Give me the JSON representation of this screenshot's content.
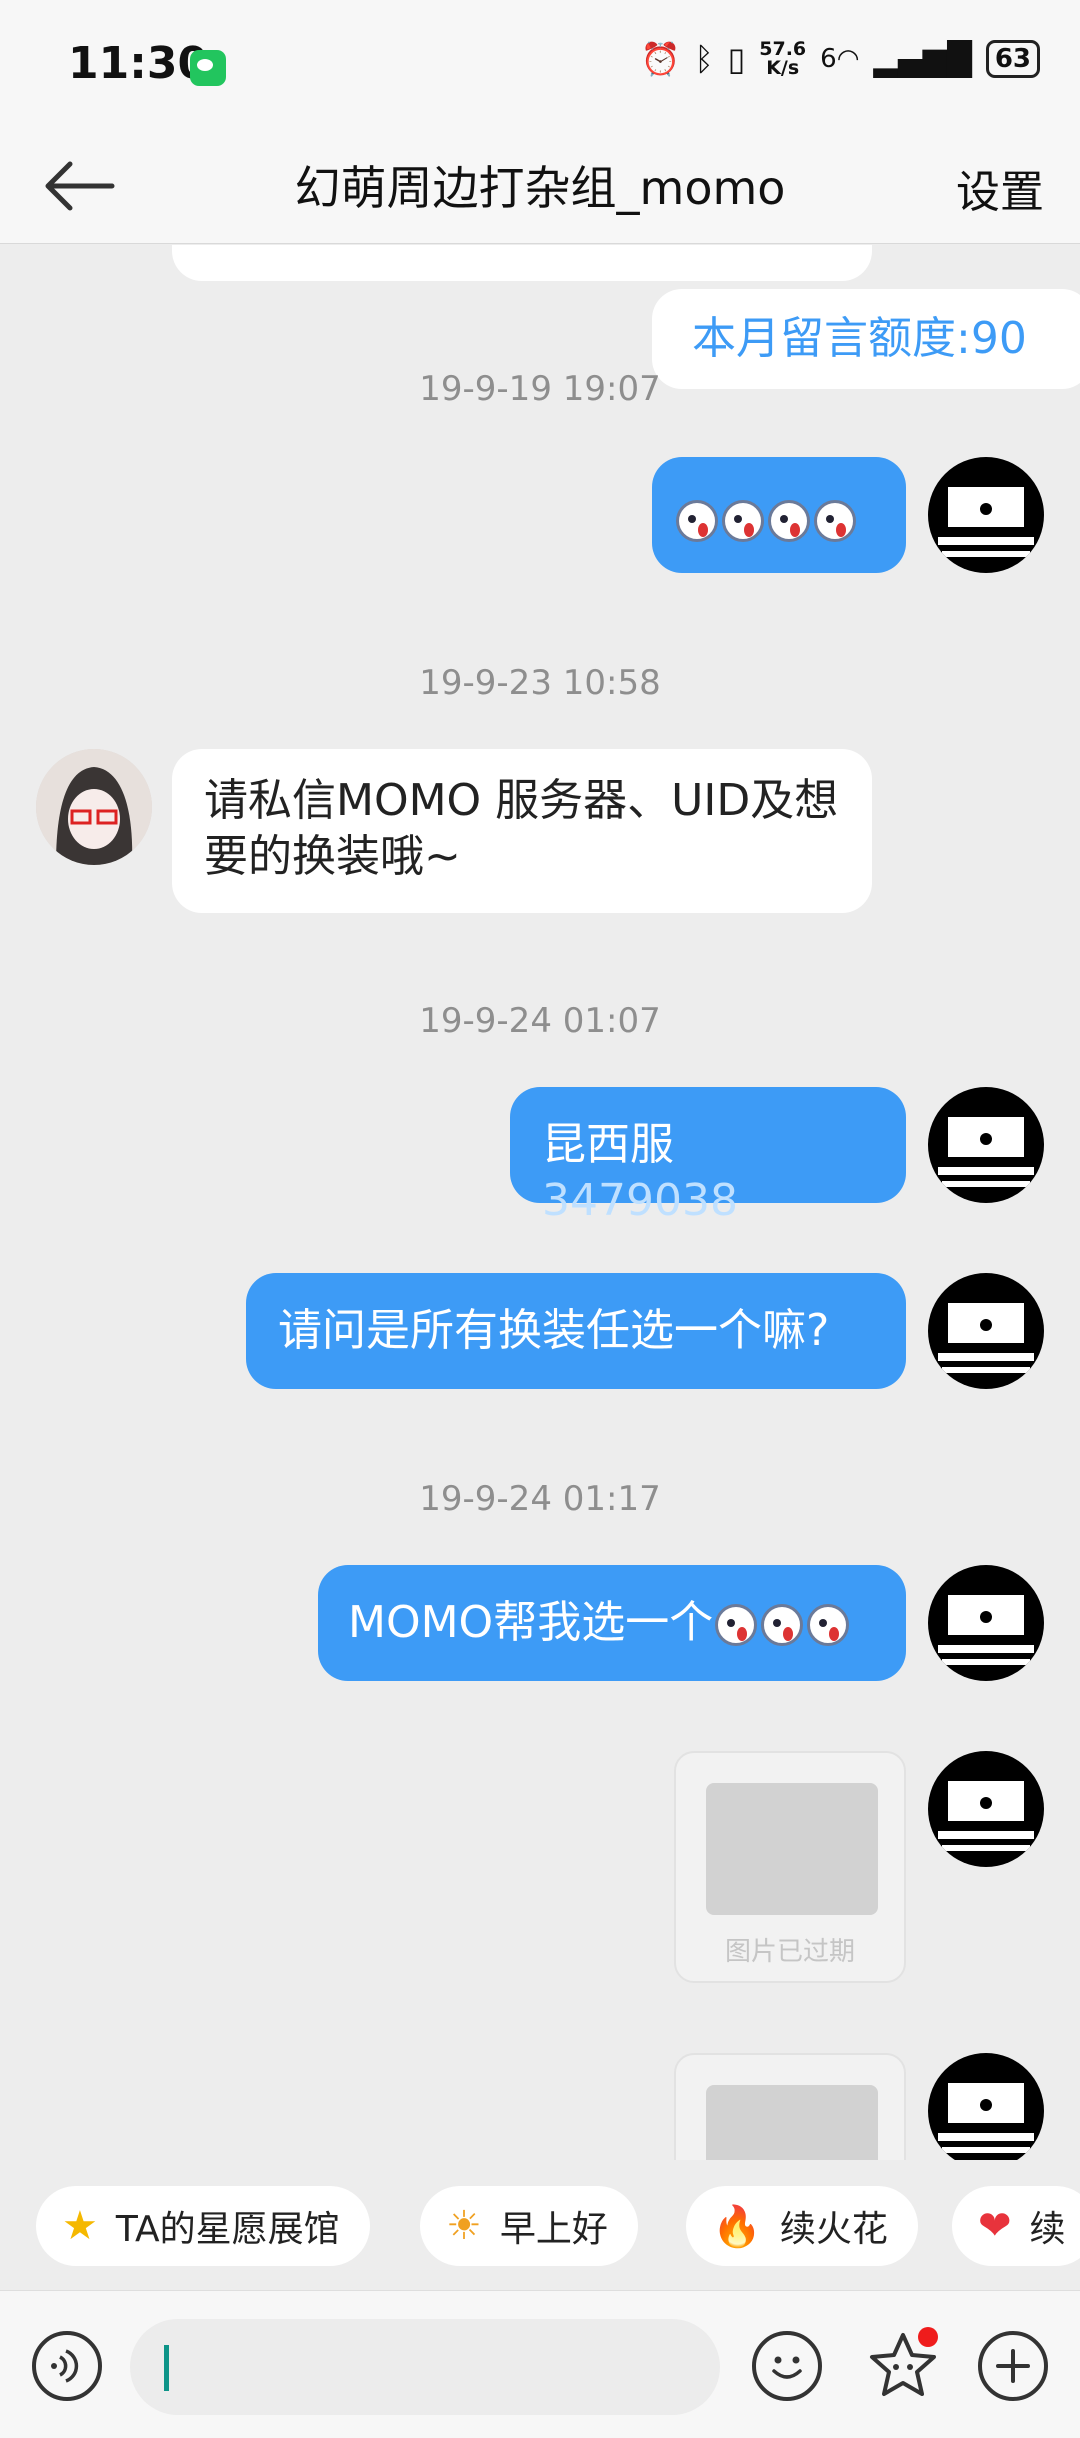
{
  "status_bar": {
    "time": "11:30",
    "net_speed_value": "57.6",
    "net_speed_unit": "K/s",
    "signal_label": "6",
    "battery": "63"
  },
  "header": {
    "title": "幻萌周边打杂组_momo",
    "settings_label": "设置"
  },
  "messages": {
    "partial_top": "...",
    "quota": "本月留言额度:90",
    "ts1": "19-9-19 19:07",
    "ts2": "19-9-23 10:58",
    "incoming_text": "请私信MOMO 服务器、UID及想要的换装哦~",
    "ts3": "19-9-24 01:07",
    "server_text": "昆西服",
    "server_uid": "3479038",
    "question_text": "请问是所有换装任选一个嘛?",
    "ts4": "19-9-24 01:17",
    "pick_text": "MOMO帮我选一个",
    "expired_caption": "图片已过期"
  },
  "quick_chips": [
    {
      "icon": "star-icon",
      "label": "TA的星愿展馆"
    },
    {
      "icon": "sun-emoji-icon",
      "label": "早上好"
    },
    {
      "icon": "fire-icon",
      "label": "续火花"
    },
    {
      "icon": "heart-icon",
      "label": "续"
    }
  ],
  "colors": {
    "accent": "#3d9bf6",
    "background": "#ededed"
  }
}
